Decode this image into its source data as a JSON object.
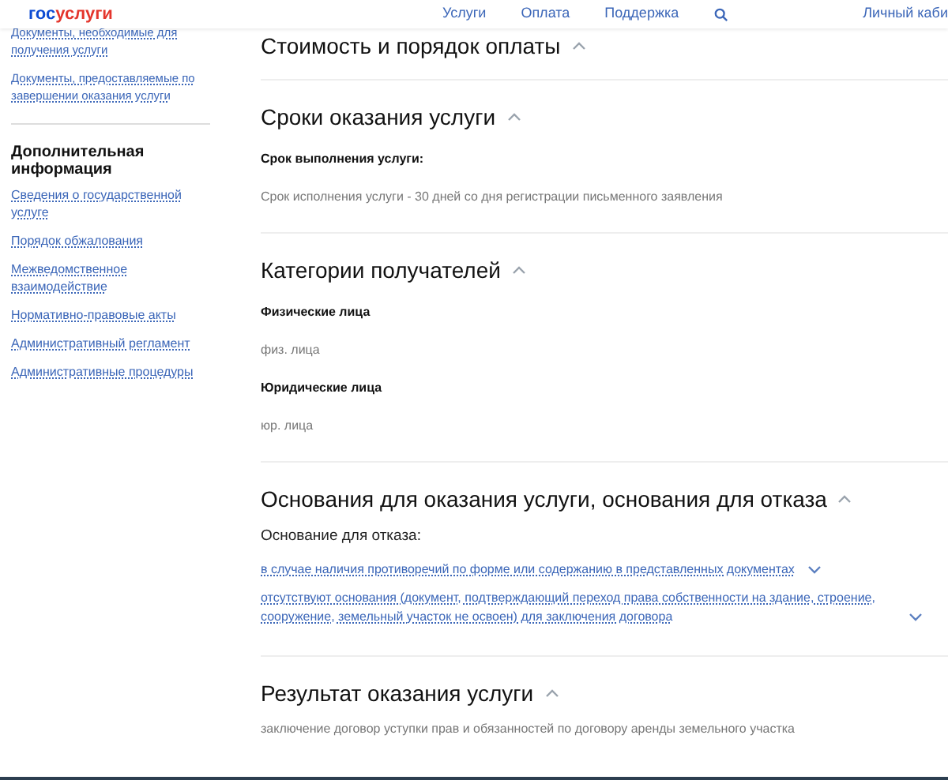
{
  "header": {
    "logo_left": "гос",
    "logo_right": "услуги",
    "nav": [
      {
        "label": "Услуги"
      },
      {
        "label": "Оплата"
      },
      {
        "label": "Поддержка"
      }
    ],
    "account": "Личный каби"
  },
  "sidebar": {
    "top_links": [
      "Документы, необходимые для получения услуги",
      "Документы, предоставляемые по завершении оказания услуги"
    ],
    "heading": "Дополнительная информация",
    "links": [
      "Сведения о государственной услуге",
      "Порядок обжалования",
      "Межведомственное взаимодействие",
      "Нормативно-правовые акты",
      "Административный регламент",
      "Административные процедуры"
    ]
  },
  "sections": [
    {
      "title": "Стоимость и порядок оплаты",
      "expanded": true
    },
    {
      "title": "Сроки оказания услуги",
      "expanded": true,
      "items": [
        {
          "kind": "label",
          "text": "Срок выполнения услуги:"
        },
        {
          "kind": "text",
          "text": "Срок исполнения услуги - 30 дней со дня регистрации письменного заявления"
        }
      ]
    },
    {
      "title": "Категории получателей",
      "expanded": true,
      "items": [
        {
          "kind": "label",
          "text": "Физические лица"
        },
        {
          "kind": "text",
          "text": "физ. лица"
        },
        {
          "kind": "label",
          "text": "Юридические лица"
        },
        {
          "kind": "text",
          "text": "юр. лица"
        }
      ]
    },
    {
      "title": "Основания для оказания услуги, основания для отказа",
      "expanded": true,
      "items": [
        {
          "kind": "subheading",
          "text": "Основание для отказа:"
        },
        {
          "kind": "link",
          "text": "в случае наличия противоречий по форме или содержанию в представленных документах",
          "expanded": false
        },
        {
          "kind": "link",
          "text": "отсутствуют основания (документ, подтверждающий переход права собственности на здание, строение, сооружение, земельный участок не освоен) для заключения договора",
          "expanded": false
        }
      ]
    },
    {
      "title": "Результат оказания услуги",
      "expanded": true,
      "items": [
        {
          "kind": "text",
          "text": "заключение договор уступки прав и обязанностей по договору аренды земельного участка"
        }
      ]
    }
  ]
}
